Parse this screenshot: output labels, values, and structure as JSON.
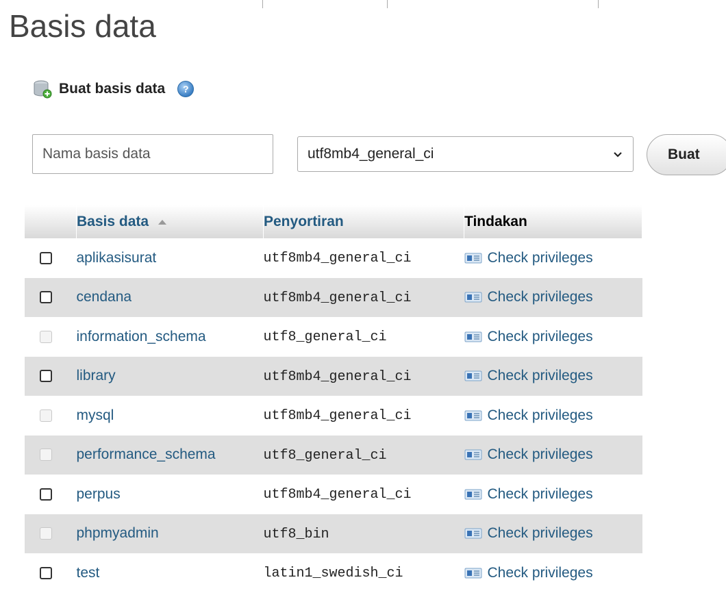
{
  "page": {
    "title": "Basis data"
  },
  "create": {
    "header": "Buat basis data",
    "name_placeholder": "Nama basis data",
    "collation_selected": "utf8mb4_general_ci",
    "submit_label": "Buat"
  },
  "table": {
    "headers": {
      "name": "Basis data",
      "collation": "Penyortiran",
      "action": "Tindakan"
    },
    "rows": [
      {
        "name": "aplikasisurat",
        "collation": "utf8mb4_general_ci",
        "action": "Check privileges",
        "checkbox_enabled": true
      },
      {
        "name": "cendana",
        "collation": "utf8mb4_general_ci",
        "action": "Check privileges",
        "checkbox_enabled": true
      },
      {
        "name": "information_schema",
        "collation": "utf8_general_ci",
        "action": "Check privileges",
        "checkbox_enabled": false
      },
      {
        "name": "library",
        "collation": "utf8mb4_general_ci",
        "action": "Check privileges",
        "checkbox_enabled": true
      },
      {
        "name": "mysql",
        "collation": "utf8mb4_general_ci",
        "action": "Check privileges",
        "checkbox_enabled": false
      },
      {
        "name": "performance_schema",
        "collation": "utf8_general_ci",
        "action": "Check privileges",
        "checkbox_enabled": false
      },
      {
        "name": "perpus",
        "collation": "utf8mb4_general_ci",
        "action": "Check privileges",
        "checkbox_enabled": true
      },
      {
        "name": "phpmyadmin",
        "collation": "utf8_bin",
        "action": "Check privileges",
        "checkbox_enabled": false
      },
      {
        "name": "test",
        "collation": "latin1_swedish_ci",
        "action": "Check privileges",
        "checkbox_enabled": true
      }
    ]
  },
  "colors": {
    "link": "#235a81",
    "row_alt": "#dfdfdf",
    "title": "#444444"
  }
}
